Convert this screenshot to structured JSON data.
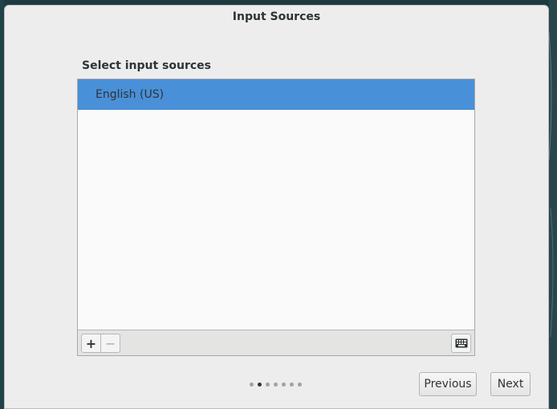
{
  "dialog": {
    "title": "Input Sources",
    "section_label": "Select input sources"
  },
  "input_sources": {
    "items": [
      {
        "label": "English (US)",
        "selected": true
      }
    ],
    "toolbar": {
      "add_icon": "plus-icon",
      "remove_icon": "minus-icon",
      "keyboard_icon": "keyboard-icon",
      "add_symbol": "+",
      "remove_symbol": "−"
    }
  },
  "pager": {
    "total_pages": 7,
    "current_page": 2
  },
  "navigation": {
    "previous_label": "Previous",
    "next_label": "Next"
  },
  "colors": {
    "selection": "#4a90d9",
    "dialog_bg": "#ededed",
    "desktop_bg": "#1e3a3f"
  }
}
